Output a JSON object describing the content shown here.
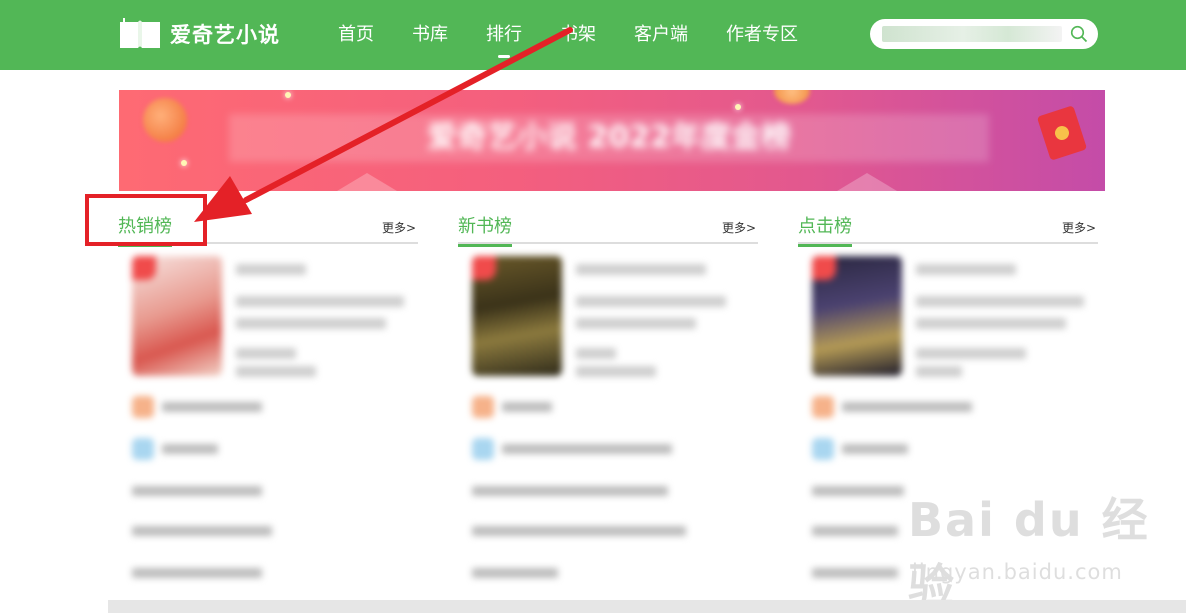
{
  "header": {
    "logo_text": "爱奇艺小说",
    "logo_icon": "open-book-icon",
    "nav": [
      {
        "label": "首页",
        "active": false
      },
      {
        "label": "书库",
        "active": false
      },
      {
        "label": "排行",
        "active": true
      },
      {
        "label": "书架",
        "active": false
      },
      {
        "label": "客户端",
        "active": false
      },
      {
        "label": "作者专区",
        "active": false
      }
    ],
    "search_icon": "search-icon"
  },
  "banner": {
    "slogan": "爱奇艺小说 2022年度金榜"
  },
  "rankings": [
    {
      "title": "热销榜",
      "more": "更多>"
    },
    {
      "title": "新书榜",
      "more": "更多>"
    },
    {
      "title": "点击榜",
      "more": "更多>"
    }
  ],
  "watermark": {
    "brand": "Bai du 经验",
    "url": "jingyan.baidu.com"
  },
  "colors": {
    "header_green": "#52b756",
    "annotation_red": "#e42127"
  }
}
